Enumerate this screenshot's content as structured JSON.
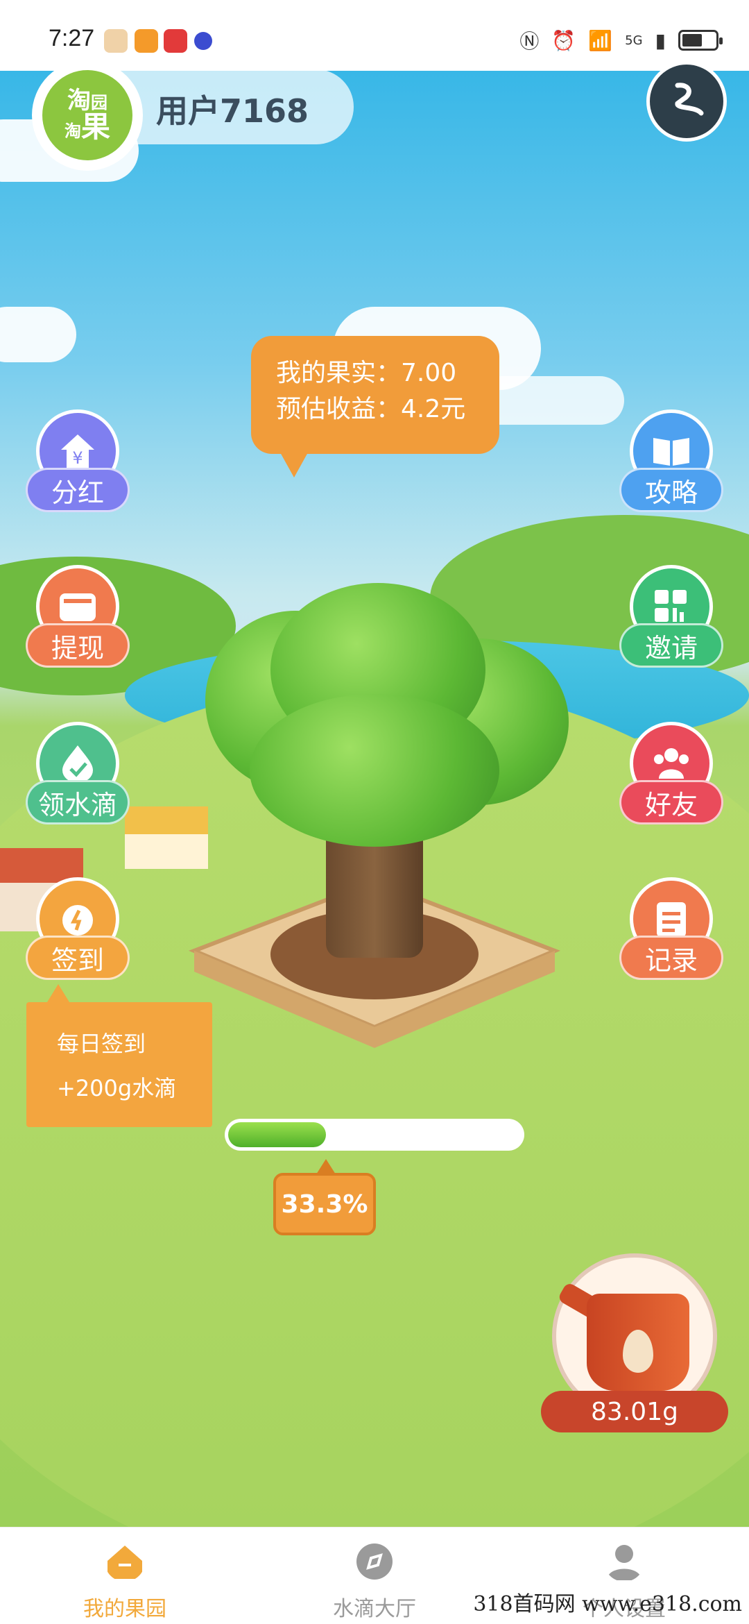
{
  "status_bar": {
    "time": "7:27",
    "network": "5G"
  },
  "profile": {
    "username": "用户7168",
    "logo_text": [
      "淘",
      "淘",
      "果",
      "园"
    ]
  },
  "side_left": [
    {
      "id": "dividend",
      "label": "分红",
      "icon": "yuan-house-icon",
      "color": "#7f7ff0"
    },
    {
      "id": "withdraw",
      "label": "提现",
      "icon": "wallet-icon",
      "color": "#f07a4e"
    },
    {
      "id": "water",
      "label": "领水滴",
      "icon": "water-drop-check-icon",
      "color": "#4fc08d"
    },
    {
      "id": "checkin",
      "label": "签到",
      "icon": "alarm-clock-icon",
      "color": "#f3a53f"
    }
  ],
  "side_right": [
    {
      "id": "guide",
      "label": "攻略",
      "icon": "book-icon",
      "color": "#4ea1f0"
    },
    {
      "id": "invite",
      "label": "邀请",
      "icon": "grid-apps-icon",
      "color": "#3cbf78"
    },
    {
      "id": "friends",
      "label": "好友",
      "icon": "friends-icon",
      "color": "#ea4b5b"
    },
    {
      "id": "records",
      "label": "记录",
      "icon": "clipboard-icon",
      "color": "#f07a4e"
    }
  ],
  "fruit_tip": {
    "line1": "我的果实：7.00",
    "line2": "预估收益：4.2元"
  },
  "signin_popup": {
    "line1": "每日签到",
    "line2": "+200g水滴"
  },
  "progress": {
    "value": 0.333,
    "label": "33.3%"
  },
  "water": {
    "amount": "83.01g"
  },
  "bottom_nav": [
    {
      "label": "我的果园",
      "icon": "home-icon",
      "active": true
    },
    {
      "label": "水滴大厅",
      "icon": "compass-icon",
      "active": false
    },
    {
      "label": "个人设置",
      "icon": "person-icon",
      "active": false
    }
  ],
  "watermark": "318首码网 www.e318.com",
  "colors": {
    "orange": "#f19c3a",
    "active_nav": "#f2a93b",
    "inactive_nav": "#9a9a9a"
  }
}
